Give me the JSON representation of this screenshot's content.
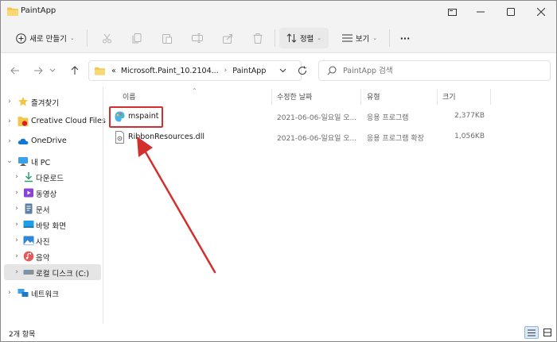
{
  "window": {
    "title": "PaintApp"
  },
  "toolbar": {
    "new_label": "새로 만들기",
    "sort_label": "정렬",
    "view_label": "보기",
    "more_label": "···"
  },
  "address": {
    "overflow": "«",
    "crumbs": [
      "Microsoft.Paint_10.2104...",
      "PaintApp"
    ]
  },
  "search": {
    "placeholder": "PaintApp 검색"
  },
  "nav": {
    "items": [
      {
        "label": "즐겨찾기"
      },
      {
        "label": "Creative Cloud Files"
      },
      {
        "label": "OneDrive"
      },
      {
        "label": "내 PC"
      },
      {
        "label": "다운로드"
      },
      {
        "label": "동영상"
      },
      {
        "label": "문서"
      },
      {
        "label": "바탕 화면"
      },
      {
        "label": "사진"
      },
      {
        "label": "음악"
      },
      {
        "label": "로컬 디스크 (C:)"
      },
      {
        "label": "네트워크"
      }
    ]
  },
  "columns": {
    "name": "이름",
    "modified": "수정한 날짜",
    "type": "유형",
    "size": "크기"
  },
  "files": [
    {
      "name": "mspaint",
      "modified": "2021-06-06-일요일 오...",
      "type": "응용 프로그램",
      "size": "2,377KB"
    },
    {
      "name": "RibbonResources.dll",
      "modified": "2021-06-06-일요일 오...",
      "type": "응용 프로그램 확장",
      "size": "1,056KB"
    }
  ],
  "status": {
    "count": "2개 항목"
  },
  "colors": {
    "annotation": "#d32f2f",
    "folder": "#f3c64a",
    "accent": "#0067c0"
  }
}
